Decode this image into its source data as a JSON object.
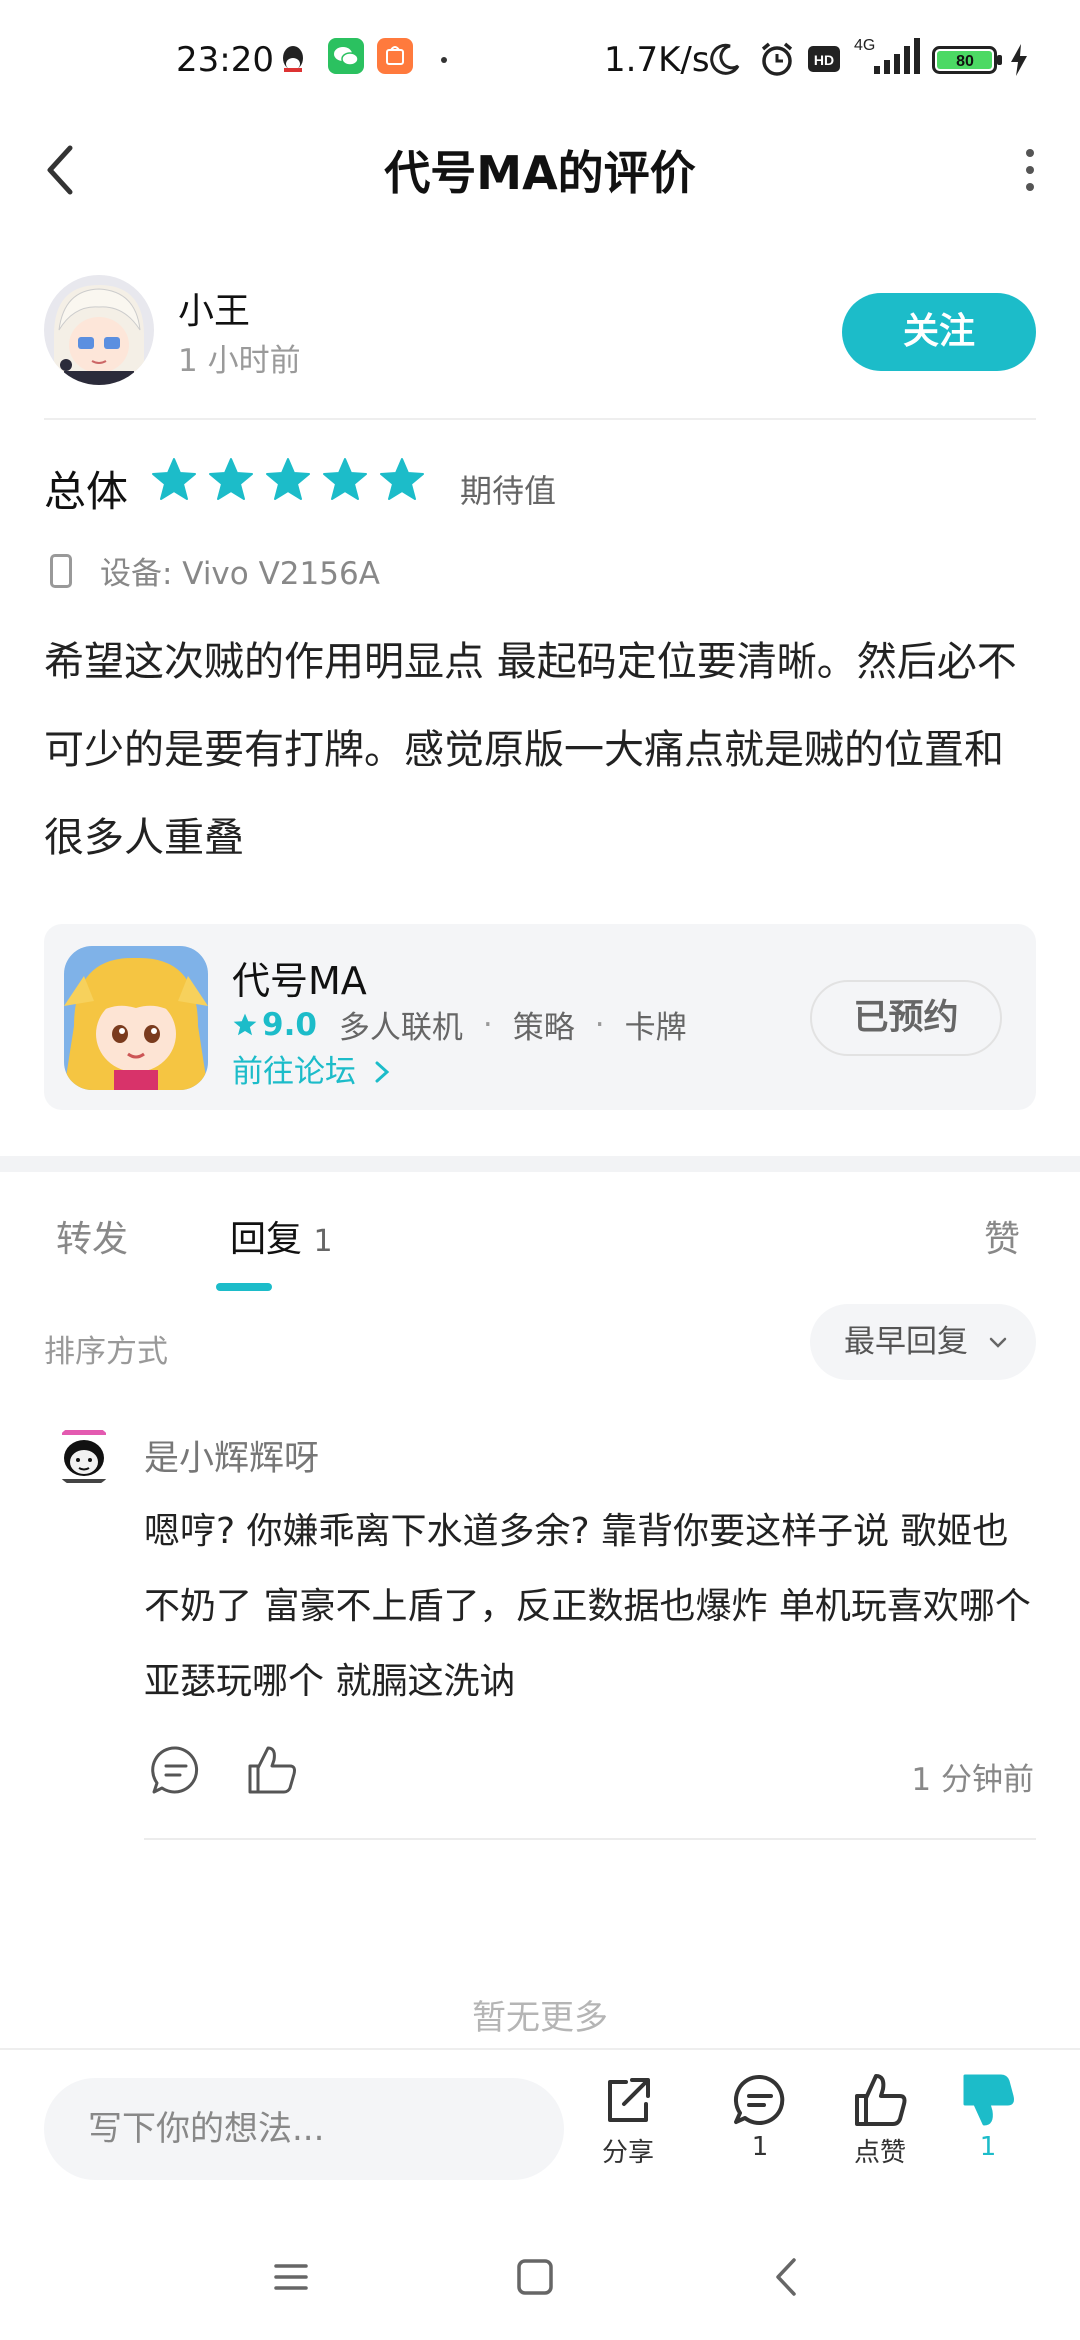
{
  "status_bar": {
    "time": "23:20",
    "network_speed": "1.7K/s",
    "hd_badge": "HD",
    "network_type": "4G",
    "battery": "80",
    "icons": [
      "qq-icon",
      "wechat-icon",
      "mi-store-icon",
      "moon-icon",
      "alarm-icon",
      "signal-icon",
      "battery-icon",
      "charging-icon"
    ]
  },
  "header": {
    "title": "代号MA的评价"
  },
  "author": {
    "name": "小王",
    "time": "1 小时前",
    "follow_label": "关注"
  },
  "rating": {
    "label": "总体",
    "stars": 5,
    "text": "期待值",
    "star_color": "#1cbcc9"
  },
  "device": {
    "text": "设备: Vivo V2156A"
  },
  "review": {
    "text": "希望这次贼的作用明显点 最起码定位要清晰。然后必不可少的是要有打牌。感觉原版一大痛点就是贼的位置和很多人重叠"
  },
  "app_card": {
    "name": "代号MA",
    "score": "9.0",
    "tags": [
      "多人联机",
      "策略",
      "卡牌"
    ],
    "forum_link": "前往论坛",
    "reserve_label": "已预约"
  },
  "tabs": {
    "forward": "转发",
    "reply": "回复",
    "reply_count": "1",
    "like": "赞"
  },
  "sort": {
    "label": "排序方式",
    "selected": "最早回复"
  },
  "comment": {
    "user": "是小辉辉呀",
    "text": "嗯哼? 你嫌乖离下水道多余? 靠背你要这样子说 歌姬也不奶了 富豪不上盾了，反正数据也爆炸 单机玩喜欢哪个亚瑟玩哪个 就膈这洗讷",
    "time": "1 分钟前"
  },
  "no_more": "暂无更多",
  "bottom_bar": {
    "input_placeholder": "写下你的想法...",
    "share_label": "分享",
    "comment_count": "1",
    "like_label": "点赞",
    "dislike_count": "1",
    "accent_color": "#1cbcc9"
  }
}
